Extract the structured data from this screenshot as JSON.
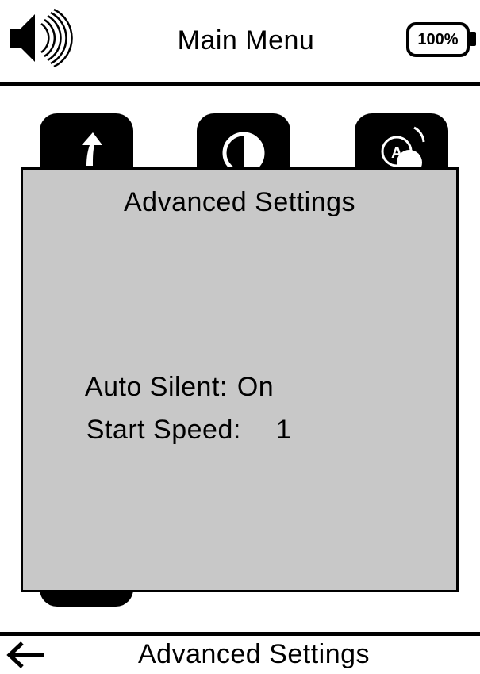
{
  "header": {
    "title": "Main Menu",
    "battery": "100%",
    "speaker_icon": "speaker-volume-icon"
  },
  "menu_tiles": [
    {
      "icon": "return-arrow-icon"
    },
    {
      "icon": "contrast-icon"
    },
    {
      "icon": "language-icon"
    },
    {
      "icon": "partial-tile"
    }
  ],
  "dialog": {
    "title": "Advanced Settings",
    "settings": [
      {
        "label": "Auto Silent:",
        "value": "On"
      },
      {
        "label": "Start Speed:",
        "value": "1"
      }
    ]
  },
  "footer": {
    "back_icon": "back-arrow-icon",
    "label": "Advanced Settings"
  },
  "colors": {
    "dialog_bg": "#c8c8c8",
    "foreground": "#000000",
    "background": "#ffffff"
  }
}
